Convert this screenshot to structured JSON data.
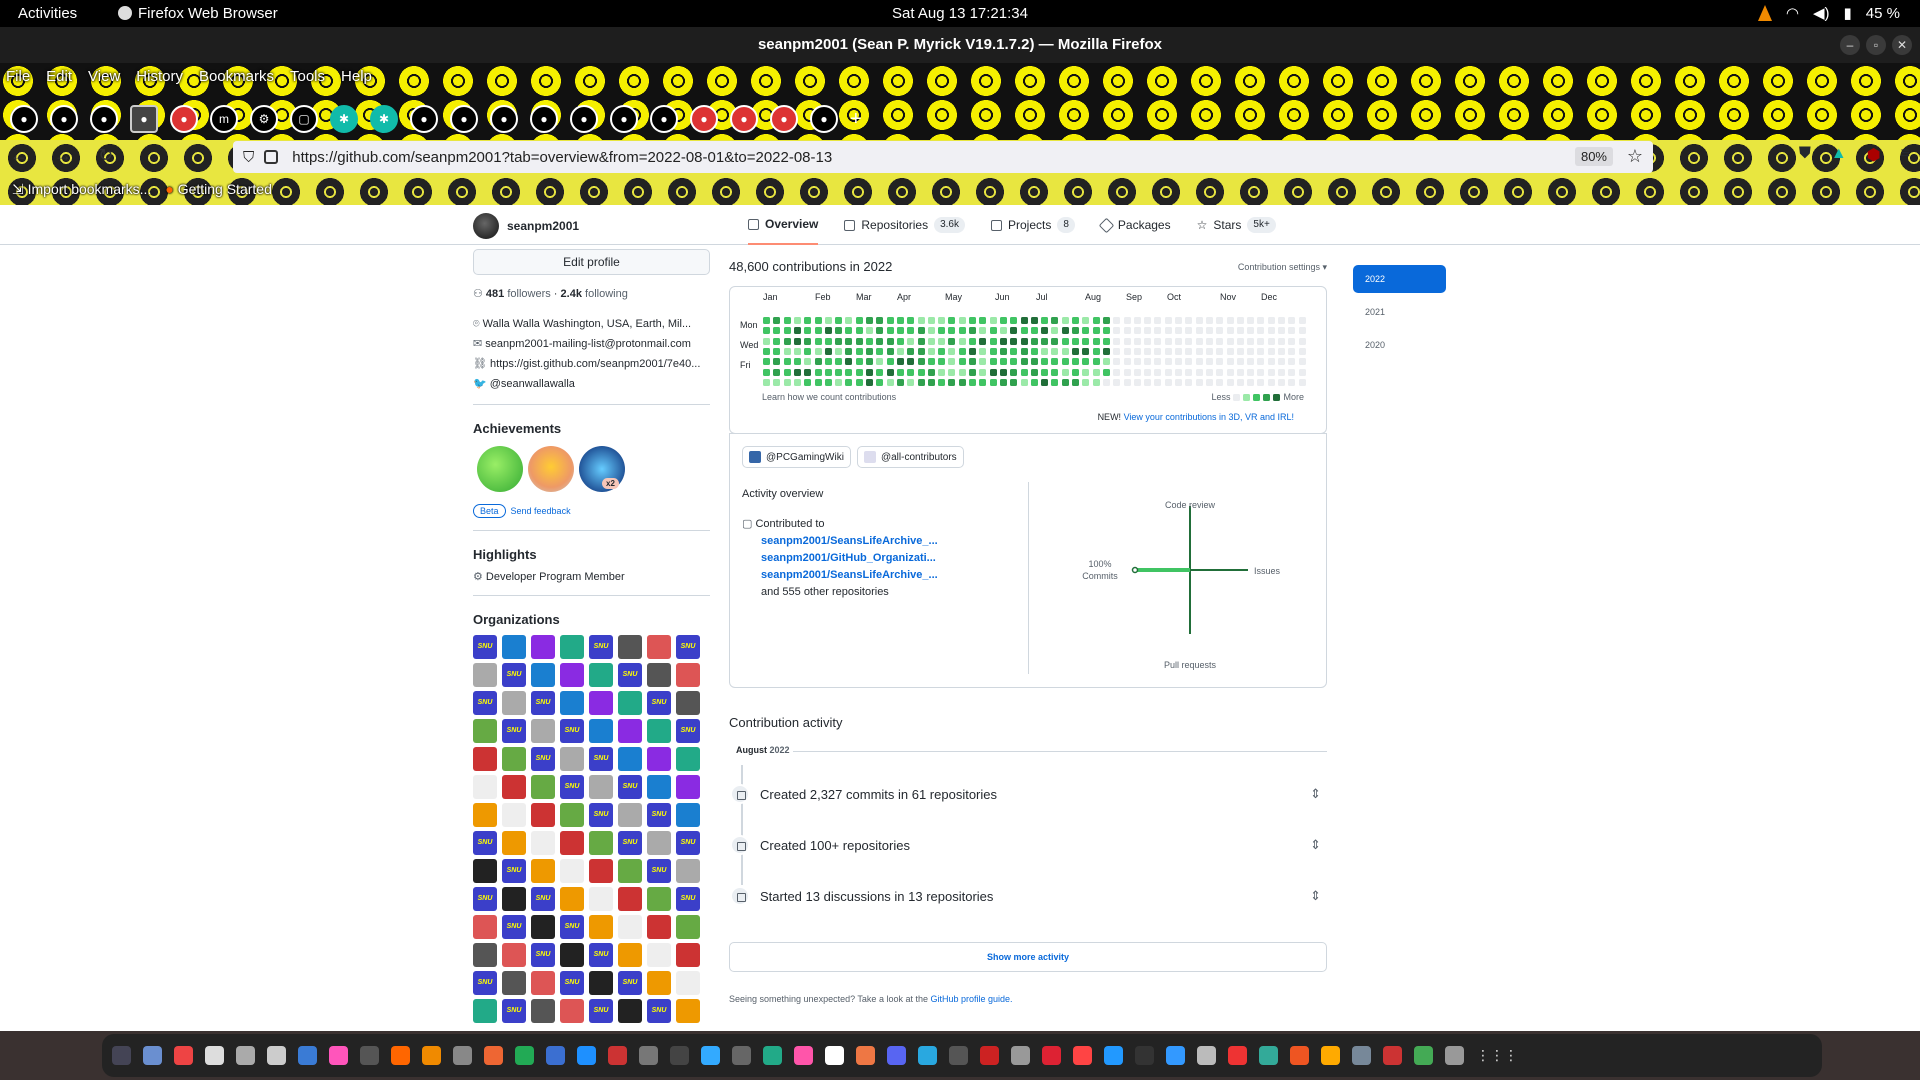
{
  "topbar": {
    "activities": "Activities",
    "app_name": "Firefox Web Browser",
    "clock": "Sat Aug 13  17:21:34",
    "battery": "45 %"
  },
  "window": {
    "title": "seanpm2001 (Sean P. Myrick V19.1.7.2) — Mozilla Firefox"
  },
  "menu": [
    "File",
    "Edit",
    "View",
    "History",
    "Bookmarks",
    "Tools",
    "Help"
  ],
  "urlbar": {
    "url": "https://github.com/seanpm2001?tab=overview&from=2022-08-01&to=2022-08-13",
    "zoom": "80%"
  },
  "bookmarks": {
    "import": "Import bookmarks...",
    "getting_started": "Getting Started"
  },
  "profile_nav": {
    "username": "seanpm2001",
    "tabs": [
      {
        "label": "Overview"
      },
      {
        "label": "Repositories",
        "count": "3.6k"
      },
      {
        "label": "Projects",
        "count": "8"
      },
      {
        "label": "Packages"
      },
      {
        "label": "Stars",
        "count": "5k+"
      }
    ]
  },
  "sidebar": {
    "edit_profile": "Edit profile",
    "followers_count": "481",
    "followers_label": "followers",
    "following_count": "2.4k",
    "following_label": "following",
    "location": "Walla Walla Washington, USA, Earth, Mil...",
    "email": "seanpm2001-mailing-list@protonmail.com",
    "website": "https://gist.github.com/seanpm2001/7e40...",
    "twitter": "@seanwallawalla",
    "achievements_title": "Achievements",
    "achievement_multiplier": "x2",
    "beta": "Beta",
    "send_feedback": "Send feedback",
    "highlights_title": "Highlights",
    "highlight_item": "Developer Program Member",
    "organizations_title": "Organizations",
    "org_logo_text": "SNU"
  },
  "contributions": {
    "heading": "48,600 contributions in 2022",
    "settings": "Contribution settings ▾",
    "months": [
      "Jan",
      "Feb",
      "Mar",
      "Apr",
      "May",
      "Jun",
      "Jul",
      "Aug",
      "Sep",
      "Oct",
      "Nov",
      "Dec"
    ],
    "weekdays": [
      "Mon",
      "Wed",
      "Fri"
    ],
    "learn_link": "Learn how we count contributions",
    "less": "Less",
    "more": "More",
    "new_label": "NEW!",
    "new_link": "View your contributions in 3D, VR and IRL!"
  },
  "activity_overview": {
    "orgs": [
      "@PCGamingWiki",
      "@all-contributors"
    ],
    "title": "Activity overview",
    "contributed_to": "Contributed to",
    "repos": [
      "seanpm2001/SeansLifeArchive_...",
      "seanpm2001/GitHub_Organizati...",
      "seanpm2001/SeansLifeArchive_..."
    ],
    "other_repos": "and 555 other repositories",
    "axes": {
      "top": "Code review",
      "right": "Issues",
      "bottom": "Pull requests",
      "left_pct": "100%",
      "left": "Commits"
    }
  },
  "contribution_activity": {
    "title": "Contribution activity",
    "month": "August",
    "year": "2022",
    "items": [
      "Created 2,327 commits in 61 repositories",
      "Created 100+ repositories",
      "Started 13 discussions in 13 repositories"
    ],
    "show_more": "Show more activity",
    "footer_text": "Seeing something unexpected? Take a look at the",
    "footer_link": "GitHub profile guide."
  },
  "year_list": [
    "2022",
    "2021",
    "2020"
  ],
  "colors": {
    "accent": "#0969da",
    "green_levels": [
      "#ebedf0",
      "#9be9a8",
      "#40c463",
      "#30a14e",
      "#216e39"
    ]
  }
}
